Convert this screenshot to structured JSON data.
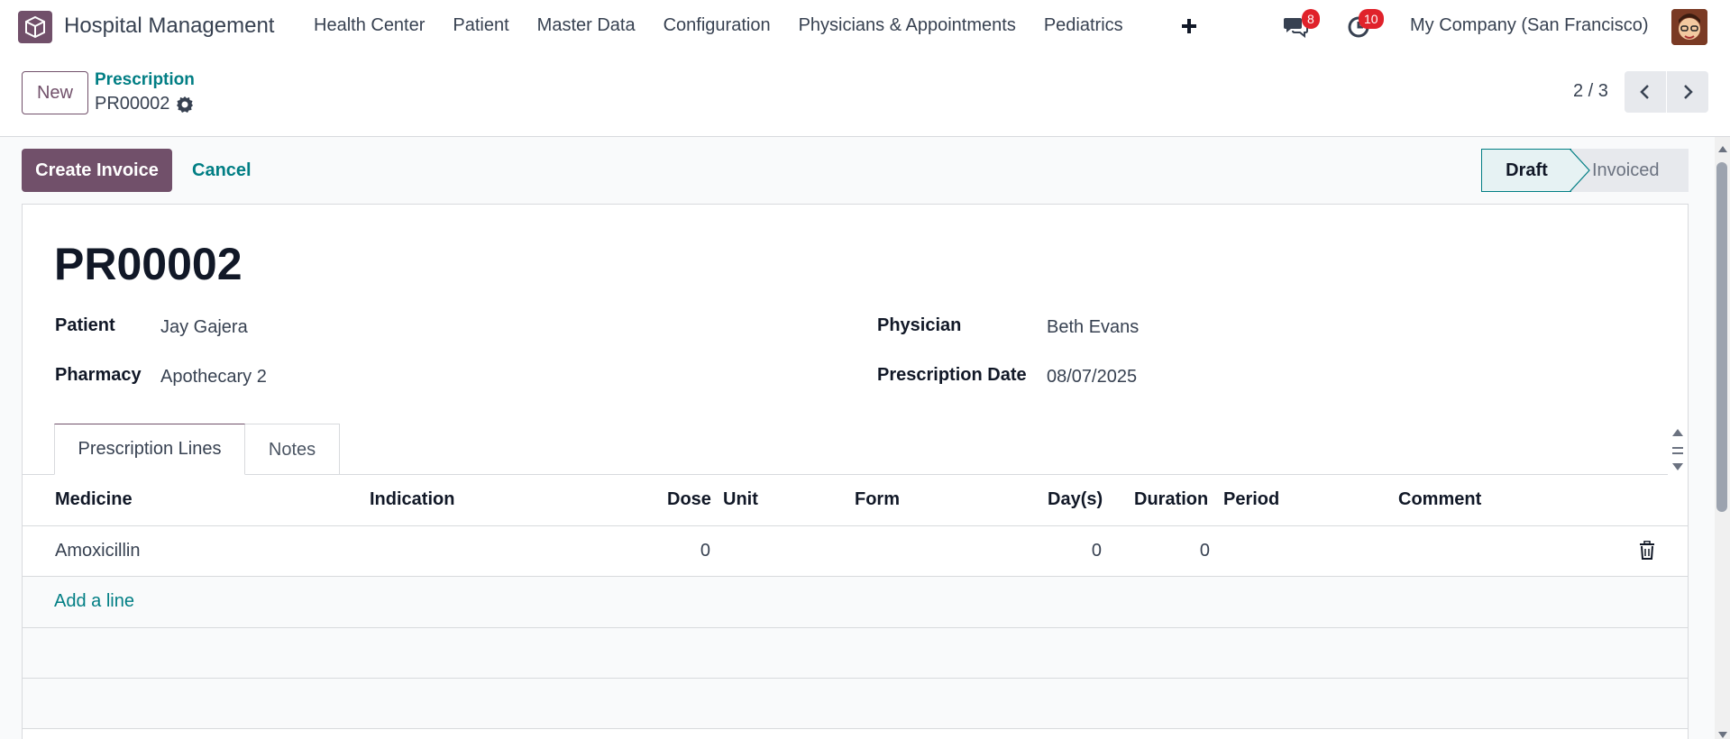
{
  "navbar": {
    "app_name": "Hospital Management",
    "menu": [
      "Health Center",
      "Patient",
      "Master Data",
      "Configuration",
      "Physicians & Appointments",
      "Pediatrics"
    ],
    "messages_count": "8",
    "activities_count": "10",
    "company": "My Company (San Francisco)"
  },
  "control_panel": {
    "new_label": "New",
    "breadcrumb": "Prescription",
    "record": "PR00002",
    "pager": "2 / 3"
  },
  "statusbar": {
    "create_invoice_label": "Create Invoice",
    "cancel_label": "Cancel",
    "stages": [
      "Draft",
      "Invoiced"
    ],
    "active_stage": "Draft"
  },
  "form": {
    "title": "PR00002",
    "patient_label": "Patient",
    "patient_value": "Jay Gajera",
    "pharmacy_label": "Pharmacy",
    "pharmacy_value": "Apothecary 2",
    "physician_label": "Physician",
    "physician_value": "Beth Evans",
    "date_label": "Prescription Date",
    "date_value": "08/07/2025"
  },
  "tabs": [
    "Prescription Lines",
    "Notes"
  ],
  "lines": {
    "headers": [
      "Medicine",
      "Indication",
      "Dose",
      "Unit",
      "Form",
      "Day(s)",
      "Duration",
      "Period",
      "Comment"
    ],
    "rows": [
      {
        "medicine": "Amoxicillin",
        "indication": "",
        "dose": "0",
        "unit": "",
        "form": "",
        "days": "0",
        "duration": "0",
        "period": "",
        "comment": ""
      }
    ],
    "add_line_label": "Add a line"
  },
  "colors": {
    "brand": "#71506a",
    "link": "#017e84",
    "badge": "#e0222b"
  }
}
